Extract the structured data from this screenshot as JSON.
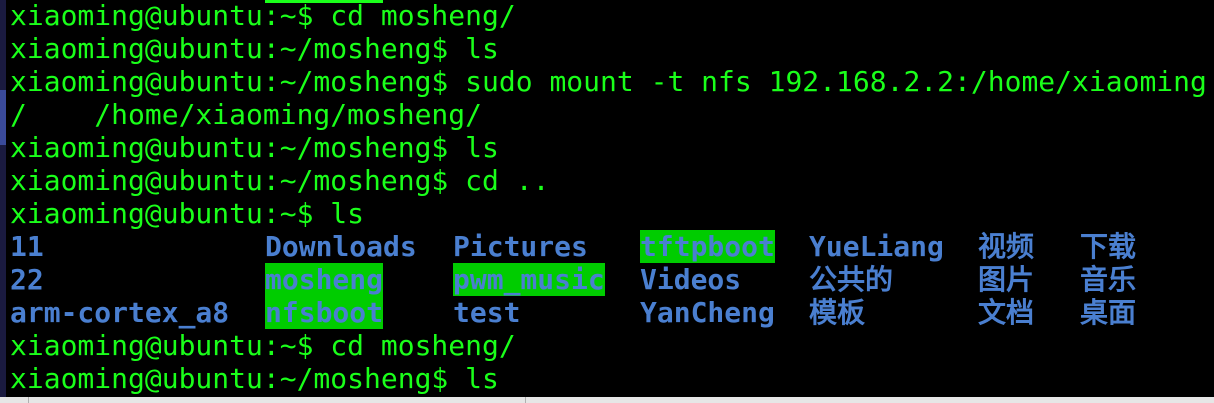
{
  "terminal": {
    "lines": [
      "xiaoming@ubuntu:~$ cd mosheng/",
      "xiaoming@ubuntu:~/mosheng$ ls",
      "xiaoming@ubuntu:~/mosheng$ sudo mount -t nfs 192.168.2.2:/home/xiaoming",
      "/    /home/xiaoming/mosheng/",
      "xiaoming@ubuntu:~/mosheng$ ls",
      "xiaoming@ubuntu:~/mosheng$ cd ..",
      "xiaoming@ubuntu:~$ ls"
    ],
    "listing": {
      "row1": [
        "11",
        "Downloads",
        "Pictures",
        "tftpboot",
        "YueLiang",
        "视频",
        "下载"
      ],
      "row2": [
        "22",
        "mosheng",
        "pwm_music",
        "Videos",
        "公共的",
        "图片",
        "音乐"
      ],
      "row3": [
        "arm-cortex_a8",
        "nfsboot",
        "test",
        "YanCheng",
        "模板",
        "文档",
        "桌面"
      ]
    },
    "after_lines": [
      "xiaoming@ubuntu:~$ cd mosheng/",
      "xiaoming@ubuntu:~/mosheng$ ls"
    ]
  },
  "colors": {
    "background": "#000000",
    "text": "#1aff1a",
    "directory": "#4a7fd0",
    "highlight": "#00cc00"
  }
}
